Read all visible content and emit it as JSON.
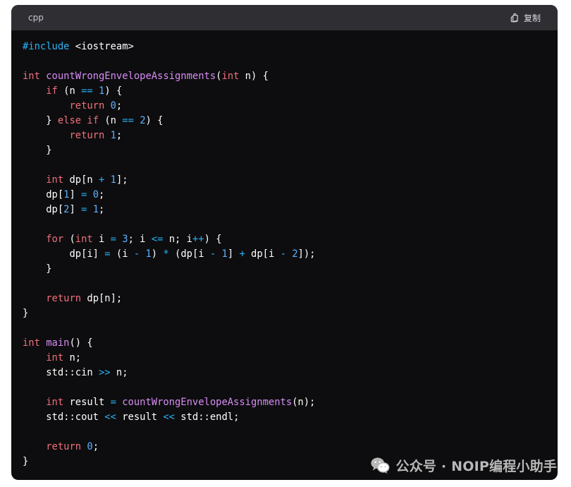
{
  "codeblock": {
    "language": "cpp",
    "copy_label": "复制",
    "copy_icon": "copy-icon",
    "lines": [
      [
        {
          "t": "pre",
          "v": "#include "
        },
        {
          "t": "inc",
          "v": "<iostream>"
        }
      ],
      [],
      [
        {
          "t": "kw",
          "v": "int"
        },
        {
          "t": "plain",
          "v": " "
        },
        {
          "t": "fn",
          "v": "countWrongEnvelopeAssignments"
        },
        {
          "t": "plain",
          "v": "("
        },
        {
          "t": "kw",
          "v": "int"
        },
        {
          "t": "plain",
          "v": " n) {"
        }
      ],
      [
        {
          "t": "plain",
          "v": "    "
        },
        {
          "t": "kw",
          "v": "if"
        },
        {
          "t": "plain",
          "v": " (n "
        },
        {
          "t": "op",
          "v": "=="
        },
        {
          "t": "plain",
          "v": " "
        },
        {
          "t": "num",
          "v": "1"
        },
        {
          "t": "plain",
          "v": ") {"
        }
      ],
      [
        {
          "t": "plain",
          "v": "        "
        },
        {
          "t": "kw",
          "v": "return"
        },
        {
          "t": "plain",
          "v": " "
        },
        {
          "t": "num",
          "v": "0"
        },
        {
          "t": "plain",
          "v": ";"
        }
      ],
      [
        {
          "t": "plain",
          "v": "    } "
        },
        {
          "t": "kw",
          "v": "else"
        },
        {
          "t": "plain",
          "v": " "
        },
        {
          "t": "kw",
          "v": "if"
        },
        {
          "t": "plain",
          "v": " (n "
        },
        {
          "t": "op",
          "v": "=="
        },
        {
          "t": "plain",
          "v": " "
        },
        {
          "t": "num",
          "v": "2"
        },
        {
          "t": "plain",
          "v": ") {"
        }
      ],
      [
        {
          "t": "plain",
          "v": "        "
        },
        {
          "t": "kw",
          "v": "return"
        },
        {
          "t": "plain",
          "v": " "
        },
        {
          "t": "num",
          "v": "1"
        },
        {
          "t": "plain",
          "v": ";"
        }
      ],
      [
        {
          "t": "plain",
          "v": "    }"
        }
      ],
      [],
      [
        {
          "t": "plain",
          "v": "    "
        },
        {
          "t": "kw",
          "v": "int"
        },
        {
          "t": "plain",
          "v": " dp[n "
        },
        {
          "t": "op",
          "v": "+"
        },
        {
          "t": "plain",
          "v": " "
        },
        {
          "t": "num",
          "v": "1"
        },
        {
          "t": "plain",
          "v": "];"
        }
      ],
      [
        {
          "t": "plain",
          "v": "    dp["
        },
        {
          "t": "num",
          "v": "1"
        },
        {
          "t": "plain",
          "v": "] "
        },
        {
          "t": "op",
          "v": "="
        },
        {
          "t": "plain",
          "v": " "
        },
        {
          "t": "num",
          "v": "0"
        },
        {
          "t": "plain",
          "v": ";"
        }
      ],
      [
        {
          "t": "plain",
          "v": "    dp["
        },
        {
          "t": "num",
          "v": "2"
        },
        {
          "t": "plain",
          "v": "] "
        },
        {
          "t": "op",
          "v": "="
        },
        {
          "t": "plain",
          "v": " "
        },
        {
          "t": "num",
          "v": "1"
        },
        {
          "t": "plain",
          "v": ";"
        }
      ],
      [],
      [
        {
          "t": "plain",
          "v": "    "
        },
        {
          "t": "kw",
          "v": "for"
        },
        {
          "t": "plain",
          "v": " ("
        },
        {
          "t": "kw",
          "v": "int"
        },
        {
          "t": "plain",
          "v": " i "
        },
        {
          "t": "op",
          "v": "="
        },
        {
          "t": "plain",
          "v": " "
        },
        {
          "t": "num",
          "v": "3"
        },
        {
          "t": "plain",
          "v": "; i "
        },
        {
          "t": "op",
          "v": "<="
        },
        {
          "t": "plain",
          "v": " n; i"
        },
        {
          "t": "op",
          "v": "++"
        },
        {
          "t": "plain",
          "v": ") {"
        }
      ],
      [
        {
          "t": "plain",
          "v": "        dp[i] "
        },
        {
          "t": "op",
          "v": "="
        },
        {
          "t": "plain",
          "v": " (i "
        },
        {
          "t": "op",
          "v": "-"
        },
        {
          "t": "plain",
          "v": " "
        },
        {
          "t": "num",
          "v": "1"
        },
        {
          "t": "plain",
          "v": ") "
        },
        {
          "t": "op",
          "v": "*"
        },
        {
          "t": "plain",
          "v": " (dp[i "
        },
        {
          "t": "op",
          "v": "-"
        },
        {
          "t": "plain",
          "v": " "
        },
        {
          "t": "num",
          "v": "1"
        },
        {
          "t": "plain",
          "v": "] "
        },
        {
          "t": "op",
          "v": "+"
        },
        {
          "t": "plain",
          "v": " dp[i "
        },
        {
          "t": "op",
          "v": "-"
        },
        {
          "t": "plain",
          "v": " "
        },
        {
          "t": "num",
          "v": "2"
        },
        {
          "t": "plain",
          "v": "]);"
        }
      ],
      [
        {
          "t": "plain",
          "v": "    }"
        }
      ],
      [],
      [
        {
          "t": "plain",
          "v": "    "
        },
        {
          "t": "kw",
          "v": "return"
        },
        {
          "t": "plain",
          "v": " dp[n];"
        }
      ],
      [
        {
          "t": "plain",
          "v": "}"
        }
      ],
      [],
      [
        {
          "t": "kw",
          "v": "int"
        },
        {
          "t": "plain",
          "v": " "
        },
        {
          "t": "fn",
          "v": "main"
        },
        {
          "t": "plain",
          "v": "() {"
        }
      ],
      [
        {
          "t": "plain",
          "v": "    "
        },
        {
          "t": "kw",
          "v": "int"
        },
        {
          "t": "plain",
          "v": " n;"
        }
      ],
      [
        {
          "t": "plain",
          "v": "    std::cin "
        },
        {
          "t": "op",
          "v": ">>"
        },
        {
          "t": "plain",
          "v": " n;"
        }
      ],
      [],
      [
        {
          "t": "plain",
          "v": "    "
        },
        {
          "t": "kw",
          "v": "int"
        },
        {
          "t": "plain",
          "v": " result "
        },
        {
          "t": "op",
          "v": "="
        },
        {
          "t": "plain",
          "v": " "
        },
        {
          "t": "fn",
          "v": "countWrongEnvelopeAssignments"
        },
        {
          "t": "plain",
          "v": "(n);"
        }
      ],
      [
        {
          "t": "plain",
          "v": "    std::cout "
        },
        {
          "t": "op",
          "v": "<<"
        },
        {
          "t": "plain",
          "v": " result "
        },
        {
          "t": "op",
          "v": "<<"
        },
        {
          "t": "plain",
          "v": " std::endl;"
        }
      ],
      [],
      [
        {
          "t": "plain",
          "v": "    "
        },
        {
          "t": "kw",
          "v": "return"
        },
        {
          "t": "plain",
          "v": " "
        },
        {
          "t": "num",
          "v": "0"
        },
        {
          "t": "plain",
          "v": ";"
        }
      ],
      [
        {
          "t": "plain",
          "v": "}"
        }
      ]
    ]
  },
  "watermark": {
    "icon": "wechat-icon",
    "text": "公众号 · NOIP编程小助手"
  },
  "colors": {
    "card_bg": "#0d0d0f",
    "header_bg": "#2f2f33",
    "keyword": "#f06f7a",
    "function": "#d88cf4",
    "number": "#5bb1ff",
    "operator": "#29b3f7",
    "preprocessor": "#29b3f7",
    "text": "#ffffff",
    "watermark": "#b8b8b8"
  }
}
